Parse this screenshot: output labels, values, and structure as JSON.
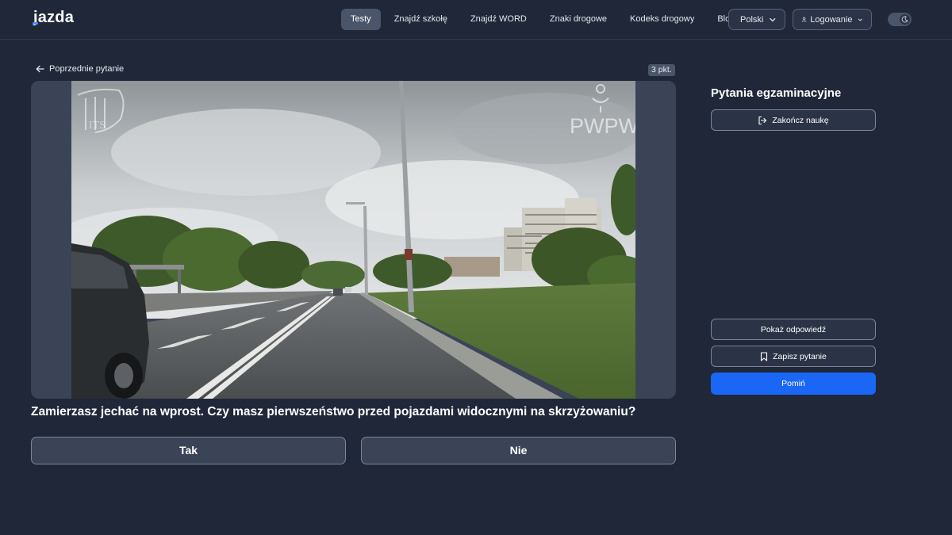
{
  "header": {
    "logo_text": "jazda",
    "nav": [
      "Testy",
      "Znajdź szkołę",
      "Znajdź WORD",
      "Znaki drogowe",
      "Kodeks drogowy",
      "Blog"
    ],
    "active_nav": "Testy",
    "language_label": "Polski",
    "login_label": "Logowanie"
  },
  "main": {
    "prev_label": "Poprzednie pytanie",
    "points_label": "3 pkt.",
    "media": {
      "watermark_left": "ITS",
      "watermark_right": "PWPW"
    },
    "question": "Zamierzasz jechać na wprost. Czy masz pierwszeństwo przed pojazdami widocznymi na skrzyżowaniu?",
    "answers": [
      "Tak",
      "Nie"
    ]
  },
  "sidebar": {
    "title": "Pytania egzaminacyjne",
    "finish_label": "Zakończ naukę",
    "show_answer_label": "Pokaż odpowiedź",
    "save_label": "Zapisz pytanie",
    "skip_label": "Pomiń"
  },
  "colors": {
    "background": "#1f2739",
    "accent": "#1a66f5",
    "surface": "#3a4456"
  }
}
